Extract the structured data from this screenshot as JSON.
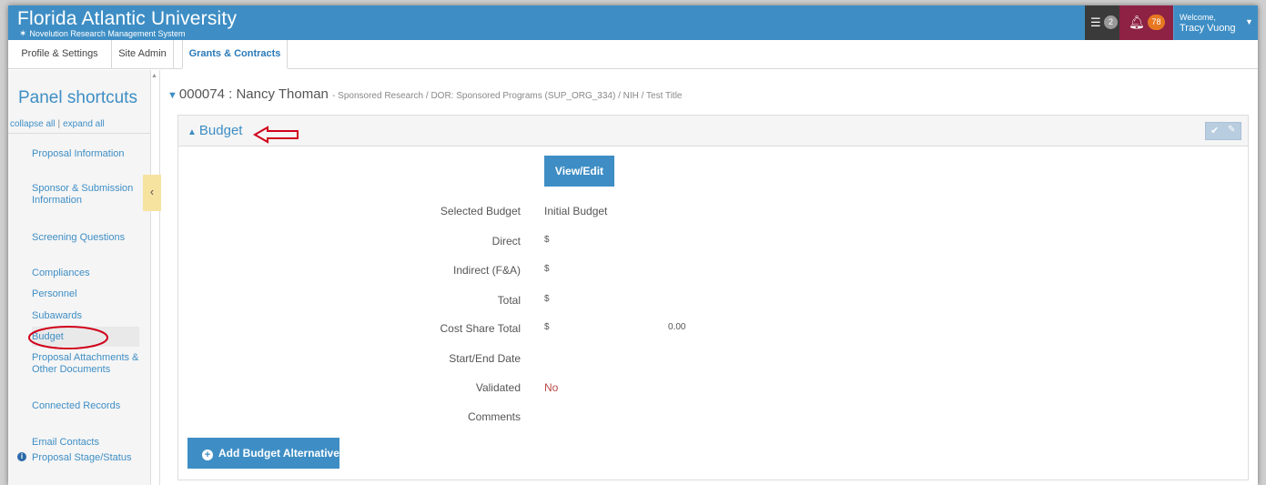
{
  "header": {
    "title": "Florida Atlantic University",
    "subtitle": "Novelution Research Management System",
    "tasks_count": "2",
    "notifications_count": "78",
    "welcome_label": "Welcome,",
    "user_name": "Tracy Vuong"
  },
  "tabs": [
    {
      "label": "Profile & Settings"
    },
    {
      "label": "Site Admin"
    },
    {
      "label": "Grants & Contracts"
    }
  ],
  "sidebar": {
    "title": "Panel shortcuts",
    "collapse_all": "collapse all",
    "separator": "|",
    "expand_all": "expand all",
    "items": [
      {
        "label": "Proposal Information"
      },
      {
        "label": "Sponsor & Submission Information"
      },
      {
        "label": "Screening Questions"
      },
      {
        "label": "Compliances"
      },
      {
        "label": "Personnel"
      },
      {
        "label": "Subawards"
      },
      {
        "label": "Budget"
      },
      {
        "label": "Proposal Attachments & Other Documents"
      },
      {
        "label": "Connected Records"
      },
      {
        "label": "Email Contacts"
      },
      {
        "label": "Proposal Stage/Status"
      }
    ]
  },
  "record": {
    "title": "000074 : Nancy Thoman",
    "path": "- Sponsored Research / DOR: Sponsored Programs (SUP_ORG_334) / NIH / Test Title"
  },
  "budget": {
    "panel_title": "Budget",
    "view_edit_label": "View/Edit",
    "rows": [
      {
        "label": "Selected Budget",
        "value": "Initial Budget",
        "amount": ""
      },
      {
        "label": "Direct",
        "value": "$",
        "amount": ""
      },
      {
        "label": "Indirect (F&A)",
        "value": "$",
        "amount": ""
      },
      {
        "label": "Total",
        "value": "$",
        "amount": ""
      },
      {
        "label": "Cost Share Total",
        "value": "$",
        "amount": "0.00"
      },
      {
        "label": "Start/End Date",
        "value": "",
        "amount": ""
      },
      {
        "label": "Validated",
        "value": "No",
        "amount": ""
      },
      {
        "label": "Comments",
        "value": "",
        "amount": ""
      }
    ],
    "add_alternative_label": "Add Budget Alternative"
  },
  "colors": {
    "brand_blue": "#3e8ec5",
    "notify_bg": "#8d2244",
    "notify_badge": "#e87722",
    "annotation_red": "#d0021b",
    "validated_no": "#b94a48"
  }
}
